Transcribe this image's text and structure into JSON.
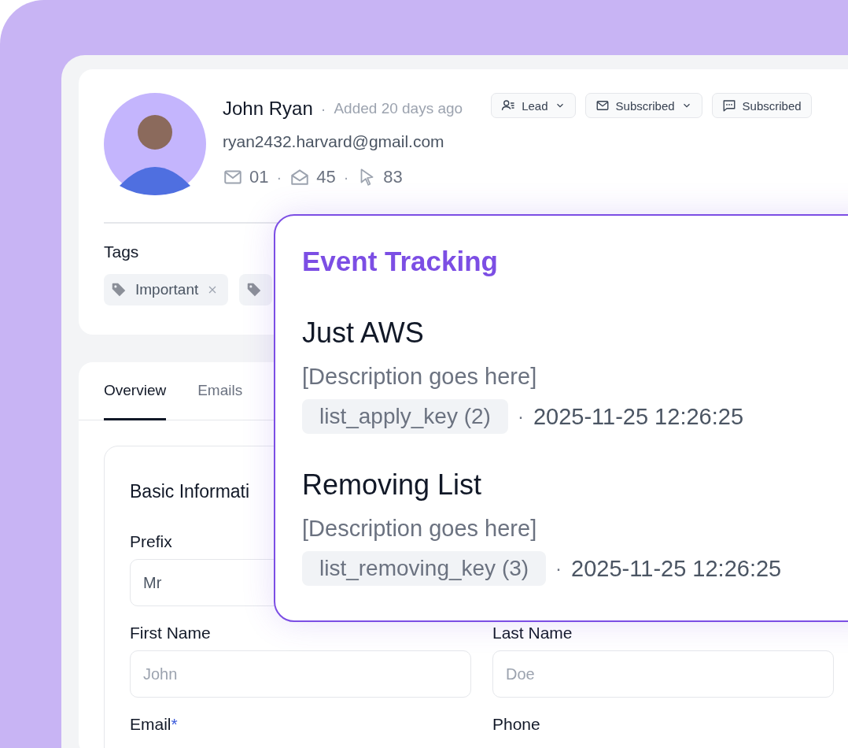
{
  "contact": {
    "name": "John Ryan",
    "separator": "·",
    "added": "Added 20 days ago",
    "email": "ryan2432.harvard@gmail.com",
    "stats": [
      {
        "kind": "sent",
        "value": "01"
      },
      {
        "kind": "opened",
        "separator": "·",
        "value": "45"
      },
      {
        "kind": "clicked",
        "separator": "·",
        "value": "83"
      }
    ],
    "badges": [
      {
        "kind": "person",
        "label": "Lead",
        "dropdown": true
      },
      {
        "kind": "mail",
        "label": "Subscribed",
        "dropdown": true
      },
      {
        "kind": "chat",
        "label": "Subscribed",
        "dropdown": false
      }
    ]
  },
  "tags": {
    "title": "Tags",
    "items": [
      {
        "kind": "label",
        "label": "Important",
        "removable": true
      },
      {
        "kind": "covered"
      }
    ]
  },
  "tabs": [
    {
      "label": "Overview",
      "selected": true
    },
    {
      "label": "Emails",
      "selected": false
    }
  ],
  "form": {
    "title": "Basic Informati",
    "rows": [
      [
        {
          "label": "Prefix",
          "value": "Mr"
        }
      ],
      [
        {
          "label": "First Name",
          "placeholder": "John"
        },
        {
          "label": "Last Name",
          "placeholder": "Doe"
        }
      ],
      [
        {
          "label": "Email",
          "required_mark": "*"
        },
        {
          "label": "Phone"
        }
      ]
    ]
  },
  "event_tracking": {
    "title": "Event Tracking",
    "events": [
      {
        "name": "Just AWS",
        "description": "[Description goes here]",
        "key": "list_apply_key (2)",
        "separator": "·",
        "time": "2025-11-25 12:26:25"
      },
      {
        "name": "Removing List",
        "description": "[Description goes here]",
        "key": "list_removing_key (3)",
        "separator": "·",
        "time": "2025-11-25 12:26:25"
      }
    ]
  }
}
